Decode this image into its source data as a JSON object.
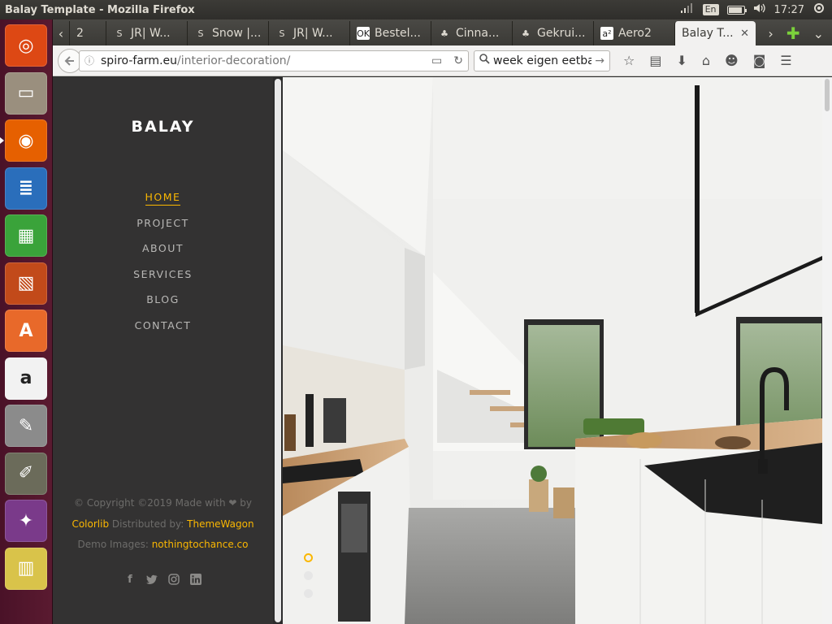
{
  "window": {
    "title": "Balay Template - Mozilla Firefox",
    "indicators": {
      "language": "En",
      "time": "17:27",
      "battery_level": 0.9
    }
  },
  "launcher": {
    "items": [
      {
        "name": "ubuntu-dash-icon",
        "color": "#dd4814"
      },
      {
        "name": "files-icon",
        "color": "#9a8f7e"
      },
      {
        "name": "firefox-icon",
        "color": "#e66000"
      },
      {
        "name": "writer-icon",
        "color": "#2a6ebb"
      },
      {
        "name": "calc-icon",
        "color": "#3aa33a"
      },
      {
        "name": "impress-icon",
        "color": "#c24a1a"
      },
      {
        "name": "software-center-icon",
        "color": "#e8692a"
      },
      {
        "name": "amazon-icon",
        "color": "#f2f2f2"
      },
      {
        "name": "system-settings-icon",
        "color": "#8b8b8b"
      },
      {
        "name": "gimp-icon",
        "color": "#6b6b5a"
      },
      {
        "name": "wizard-icon",
        "color": "#7a3a8a"
      },
      {
        "name": "workspace-icon",
        "color": "#d9c34a"
      }
    ]
  },
  "tabs": [
    {
      "label": "2",
      "favicon": ""
    },
    {
      "label": "JR| W...",
      "favicon": "S"
    },
    {
      "label": "Snow |...",
      "favicon": "S"
    },
    {
      "label": "JR| W...",
      "favicon": "S"
    },
    {
      "label": "Bestel...",
      "favicon": "OK"
    },
    {
      "label": "Cinna...",
      "favicon": "♣"
    },
    {
      "label": "Gekrui...",
      "favicon": "♣"
    },
    {
      "label": "Aero2",
      "favicon": "a²"
    },
    {
      "label": "Balay T...",
      "favicon": "",
      "active": true
    }
  ],
  "navbar": {
    "url_domain": "spiro-farm.eu",
    "url_path": "/interior-decoration/",
    "search_value": "week eigen eetbare"
  },
  "page": {
    "brand": "BALAY",
    "menu": [
      {
        "label": "HOME",
        "active": true
      },
      {
        "label": "PROJECT"
      },
      {
        "label": "ABOUT"
      },
      {
        "label": "SERVICES"
      },
      {
        "label": "BLOG"
      },
      {
        "label": "CONTACT"
      }
    ],
    "footer": {
      "line1": "© Copyright ©2019 Made with ❤ by",
      "colorlib": "Colorlib",
      "distributed": " Distributed by: ",
      "themewagon": "ThemeWagon",
      "demo": "Demo Images: ",
      "demo_link": "nothingtochance.co"
    },
    "socials": [
      "f",
      "t",
      "ig",
      "in"
    ],
    "slider": {
      "count": 3,
      "active": 0
    },
    "accent": "#fab702"
  }
}
